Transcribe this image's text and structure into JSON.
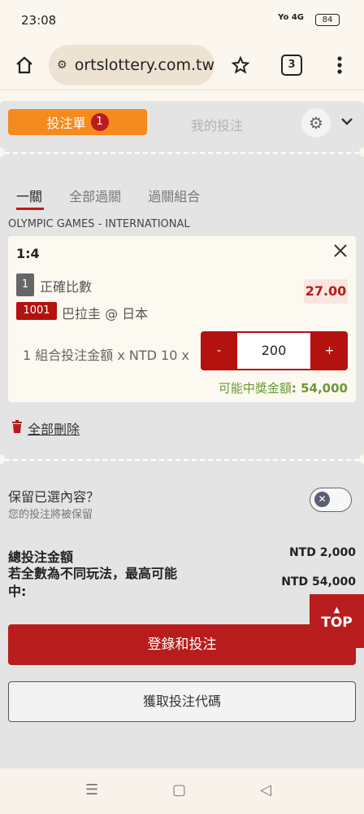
{
  "status": {
    "time": "23:08",
    "signal": "Yo 4G",
    "battery": "84"
  },
  "browser": {
    "url": "ortslottery.com.tw",
    "tab_count": "3"
  },
  "betslip": {
    "tab_betslip": "投注單",
    "tab_betslip_count": "1",
    "tab_my_bets": "我的投注",
    "subtabs": [
      "一關",
      "全部過關",
      "過關組合"
    ],
    "league": "OLYMPIC GAMES - INTERNATIONAL",
    "bet": {
      "score": "1:4",
      "selection_number": "1",
      "market": "正確比數",
      "odds": "27.00",
      "match_id": "1001",
      "match": "巴拉圭 @ 日本",
      "stake_label": "1 組合投注金額 x NTD 10 x",
      "minus": "-",
      "plus": "+",
      "stake_value": "200",
      "payout_label": "可能中獎金額",
      "payout_value": ": 54,000"
    },
    "delete_all": "全部刪除",
    "keep_title": "保留已選內容？",
    "keep_subtitle": "您的投注將被保留",
    "total_label": "總投注金額",
    "total_value": "NTD 2,000",
    "max_win_label": "若全數為不同玩法，最高可能中:",
    "max_win_value": "NTD 54,000",
    "top_label": "TOP",
    "login_button": "登錄和投注",
    "code_button": "獲取投注代碼"
  },
  "colors": {
    "accent_red": "#b81c1c",
    "accent_orange": "#f58a1f",
    "payout_green": "#6a9a3a"
  }
}
